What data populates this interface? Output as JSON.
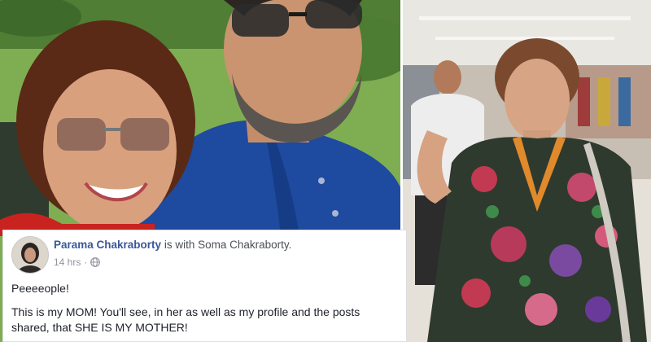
{
  "post": {
    "author": "Parama Chakraborty",
    "with_text": "is with",
    "tagged": "Soma Chakraborty.",
    "time": "14 hrs",
    "separator": "·",
    "paragraph1": "Peeeeople!",
    "paragraph2": "This is my MOM! You'll see, in her as well as my profile and the posts shared, that SHE IS MY MOTHER!"
  },
  "colors": {
    "name_link": "#385898",
    "meta_gray": "#90949c",
    "card_border": "#dddfe2",
    "body_text": "#1d2129"
  },
  "icons": {
    "privacy": "globe-icon"
  }
}
